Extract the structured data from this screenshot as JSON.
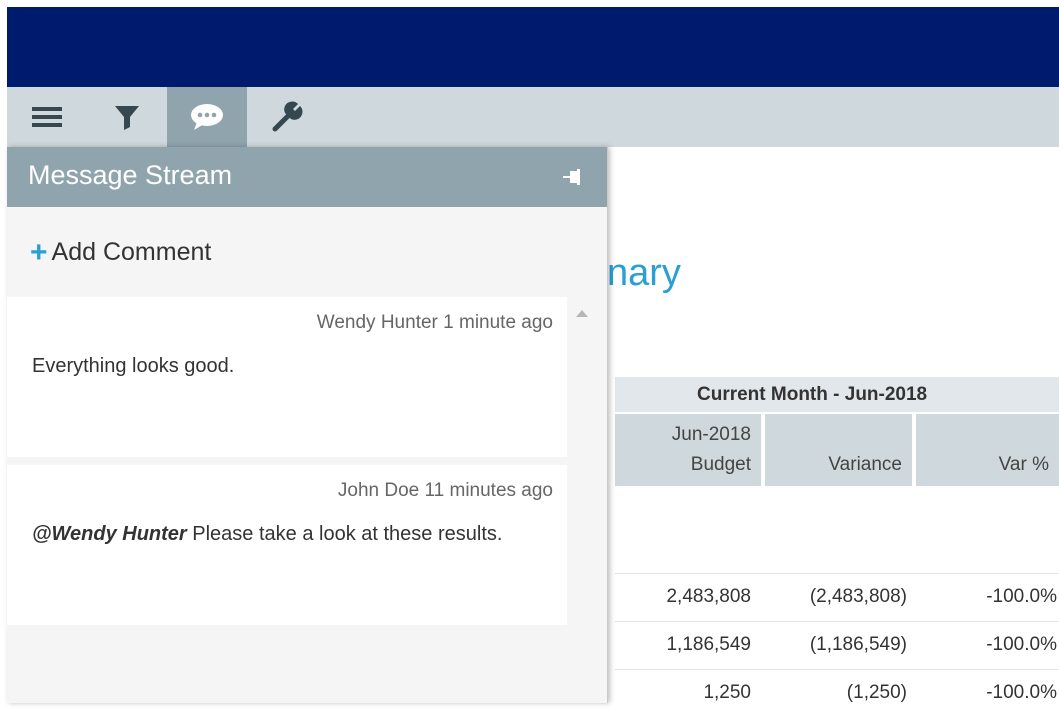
{
  "toolbar": {
    "items": [
      {
        "icon": "menu-icon",
        "active": false
      },
      {
        "icon": "filter-icon",
        "active": false
      },
      {
        "icon": "chat-bubble-icon",
        "active": true
      },
      {
        "icon": "wrench-icon",
        "active": false
      }
    ]
  },
  "panel": {
    "title": "Message Stream",
    "pin_icon": "pin-icon",
    "add_comment_label": "Add Comment",
    "messages": [
      {
        "author": "Wendy Hunter",
        "time": "1 minute ago",
        "meta": "Wendy Hunter 1 minute ago",
        "text": "Everything looks good."
      },
      {
        "author": "John Doe",
        "time": "11 minutes ago",
        "meta": "John Doe 11 minutes ago",
        "mention": "@Wendy Hunter",
        "text": " Please take a look at these results."
      }
    ]
  },
  "report": {
    "title_fragment": "nary",
    "group_header": "Current Month - Jun-2018",
    "columns": [
      {
        "line1": "Jun-2018",
        "line2": "Budget"
      },
      {
        "line1": "",
        "line2": "Variance"
      },
      {
        "line1": "",
        "line2": "Var %"
      }
    ],
    "rows": [
      [
        "2,483,808",
        "(2,483,808)",
        "-100.0%"
      ],
      [
        "1,186,549",
        "(1,186,549)",
        "-100.0%"
      ],
      [
        "1,250",
        "(1,250)",
        "-100.0%"
      ]
    ]
  },
  "colors": {
    "topbar": "#001b6e",
    "toolbar": "#cfd8dc",
    "active_tool": "#90a4ae",
    "accent": "#2a9fd6"
  }
}
